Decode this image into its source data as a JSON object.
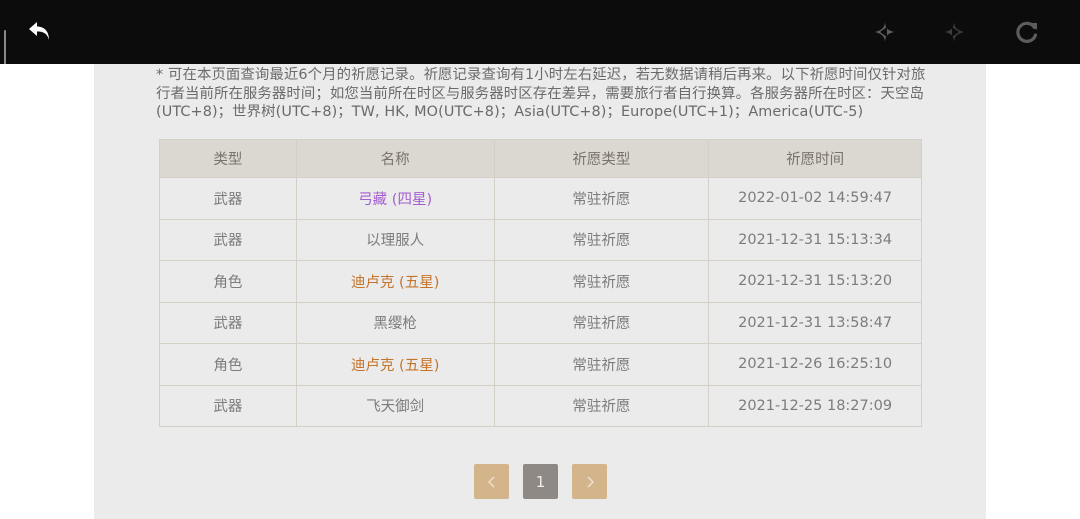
{
  "topbar": {
    "icons": {
      "back": "back-arrow-icon",
      "prev": "sparkle-prev-icon",
      "next": "sparkle-next-icon",
      "refresh": "refresh-icon"
    }
  },
  "notice": "* 可在本页面查询最近6个月的祈愿记录。祈愿记录查询有1小时左右延迟，若无数据请稍后再来。以下祈愿时间仅针对旅行者当前所在服务器时间；如您当前所在时区与服务器时区存在差异，需要旅行者自行换算。各服务器所在时区：天空岛(UTC+8)；世界树(UTC+8)；TW, HK, MO(UTC+8)；Asia(UTC+8)；Europe(UTC+1)；America(UTC-5)",
  "table": {
    "headers": [
      "类型",
      "名称",
      "祈愿类型",
      "祈愿时间"
    ],
    "rows": [
      {
        "type": "武器",
        "name": "弓藏 (四星)",
        "wish_type": "常驻祈愿",
        "time": "2022-01-02 14:59:47",
        "rarity_color": "#a45ed0"
      },
      {
        "type": "武器",
        "name": "以理服人",
        "wish_type": "常驻祈愿",
        "time": "2021-12-31 15:13:34",
        "rarity_color": "#7c7c7c"
      },
      {
        "type": "角色",
        "name": "迪卢克 (五星)",
        "wish_type": "常驻祈愿",
        "time": "2021-12-31 15:13:20",
        "rarity_color": "#c4752c"
      },
      {
        "type": "武器",
        "name": "黑缨枪",
        "wish_type": "常驻祈愿",
        "time": "2021-12-31 13:58:47",
        "rarity_color": "#7c7c7c"
      },
      {
        "type": "角色",
        "name": "迪卢克 (五星)",
        "wish_type": "常驻祈愿",
        "time": "2021-12-26 16:25:10",
        "rarity_color": "#c4752c"
      },
      {
        "type": "武器",
        "name": "飞天御剑",
        "wish_type": "常驻祈愿",
        "time": "2021-12-25 18:27:09",
        "rarity_color": "#7c7c7c"
      }
    ]
  },
  "pagination": {
    "prev": "‹",
    "current": "1",
    "next": "›"
  },
  "colors": {
    "topbar": "#0c0c0c",
    "panel": "#ebebeb",
    "header": "#dbd8d1",
    "pager_button": "#d4b48a",
    "pager_current": "#8f8985",
    "four_star": "#a45ed0",
    "five_star": "#c4752c"
  }
}
